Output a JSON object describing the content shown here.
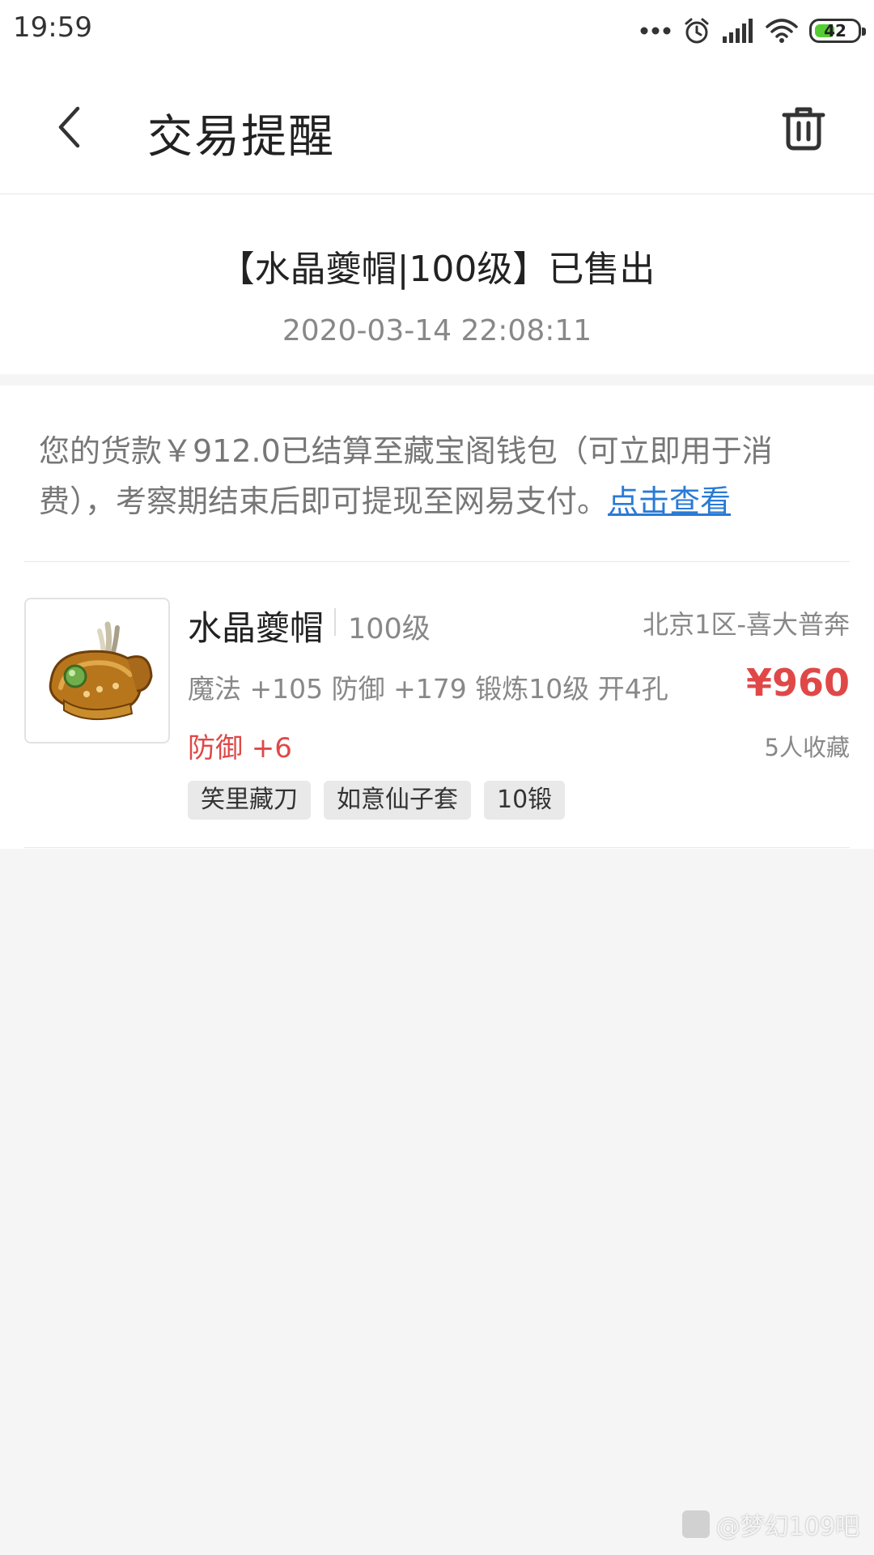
{
  "status_bar": {
    "time": "19:59",
    "battery": "42",
    "icons": [
      "more-dots-icon",
      "alarm-icon",
      "signal-icon",
      "wifi-icon",
      "battery-icon"
    ]
  },
  "header": {
    "title": "交易提醒",
    "back_icon": "chevron-left-icon",
    "delete_icon": "trash-icon"
  },
  "message": {
    "title": "【水晶夔帽|100级】已售出",
    "time": "2020-03-14 22:08:11",
    "notice_text": "您的货款￥912.0已结算至藏宝阁钱包（可立即用于消费），考察期结束后即可提现至网易支付。",
    "notice_link": "点击查看"
  },
  "item": {
    "name": "水晶夔帽",
    "level": "100级",
    "server": "北京1区-喜大普奔",
    "attributes": "魔法 +105 防御 +179 锻炼10级 开4孔",
    "price": "¥960",
    "bonus": "防御 +6",
    "favorites": "5人收藏",
    "tags": [
      "笑里藏刀",
      "如意仙子套",
      "10锻"
    ]
  },
  "watermark": {
    "text": "@梦幻109吧"
  },
  "colors": {
    "price_red": "#e04848",
    "link_blue": "#2a7ad6",
    "background": "#f5f5f5"
  }
}
